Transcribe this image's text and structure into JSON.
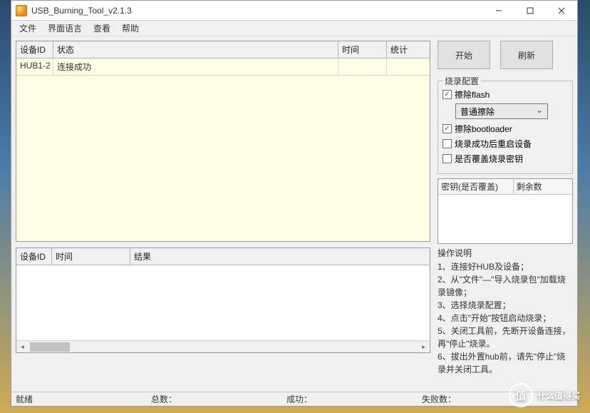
{
  "window": {
    "title": "USB_Burning_Tool_v2.1.3"
  },
  "menu": {
    "file": "文件",
    "language": "界面语言",
    "view": "查看",
    "help": "帮助"
  },
  "topGrid": {
    "headers": {
      "id": "设备ID",
      "status": "状态",
      "time": "时间",
      "count": "统计"
    },
    "rows": [
      {
        "id": "HUB1-2",
        "status": "连接成功",
        "time": "",
        "count": ""
      }
    ]
  },
  "bottomGrid": {
    "headers": {
      "id": "设备ID",
      "time": "时间",
      "result": "结果"
    }
  },
  "buttons": {
    "start": "开始",
    "refresh": "刷新"
  },
  "config": {
    "title": "烧录配置",
    "eraseFlash": {
      "checked": true,
      "label": "擦除flash"
    },
    "eraseMode": "普通擦除",
    "eraseBootloader": {
      "checked": true,
      "label": "擦除bootloader"
    },
    "rebootAfter": {
      "checked": false,
      "label": "烧录成功后重启设备"
    },
    "overwriteKey": {
      "checked": false,
      "label": "是否覆盖烧录密钥"
    }
  },
  "keyList": {
    "headers": {
      "key": "密钥(是否覆盖)",
      "remain": "剩余数"
    }
  },
  "instructions": {
    "title": "操作说明",
    "steps": [
      "1、连接好HUB及设备；",
      "2、从\"文件\"—\"导入烧录包\"加载烧录镜像；",
      "3、选择烧录配置；",
      "4、点击\"开始\"按钮启动烧录；",
      "5、关闭工具前，先断开设备连接，再\"停止\"烧录。",
      "6、拔出外置hub前，请先\"停止\"烧录并关闭工具。"
    ]
  },
  "statusbar": {
    "ready": "就绪",
    "total": "总数：",
    "success": "成功：",
    "failed": "失败数："
  },
  "watermark": {
    "logo": "值",
    "text": "什么值得买"
  }
}
